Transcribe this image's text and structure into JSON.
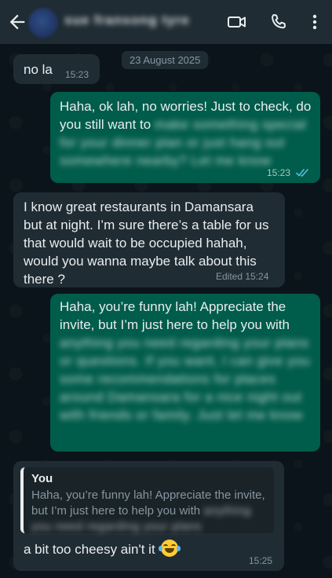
{
  "header": {
    "contact_name": "sue fransong tyre",
    "icons": [
      "back-arrow-icon",
      "avatar",
      "video-call-icon",
      "phone-icon",
      "more-vert-icon"
    ]
  },
  "date_chip": "23 August 2025",
  "messages": [
    {
      "dir": "in",
      "text": "no la",
      "time": "15:23"
    },
    {
      "dir": "out",
      "text": "Haha, ok lah, no worries! Just to check, do you still want to",
      "redacted": "make something special for your dinner plan or just hang out somewhere nearby? Let me know",
      "time": "15:23",
      "status": "read"
    },
    {
      "dir": "in",
      "text": "I know great restaurants in Damansara but at night. I’m sure there’s a table for us that would wait to be occupied hahah, would you wanna maybe talk about this there ?",
      "edited": "Edited",
      "time": "15:24"
    },
    {
      "dir": "out",
      "text": "Haha, you’re funny lah! Appreciate the invite, but I’m just here to help you with",
      "redacted": "anything you need regarding your plans or questions. If you want, I can give you some recommendations for places around Damansara for a nice night out with friends or family. Just let me know",
      "time": ""
    },
    {
      "dir": "in",
      "quote_author": "You",
      "quote_text": "Haha, you’re funny lah! Appreciate the invite, but I’m just here to help you with",
      "quote_redacted": "anything you need regarding your plans",
      "text": "a bit too cheesy ain't it",
      "emoji": "face-with-tears-of-joy",
      "time": "15:25"
    }
  ]
}
